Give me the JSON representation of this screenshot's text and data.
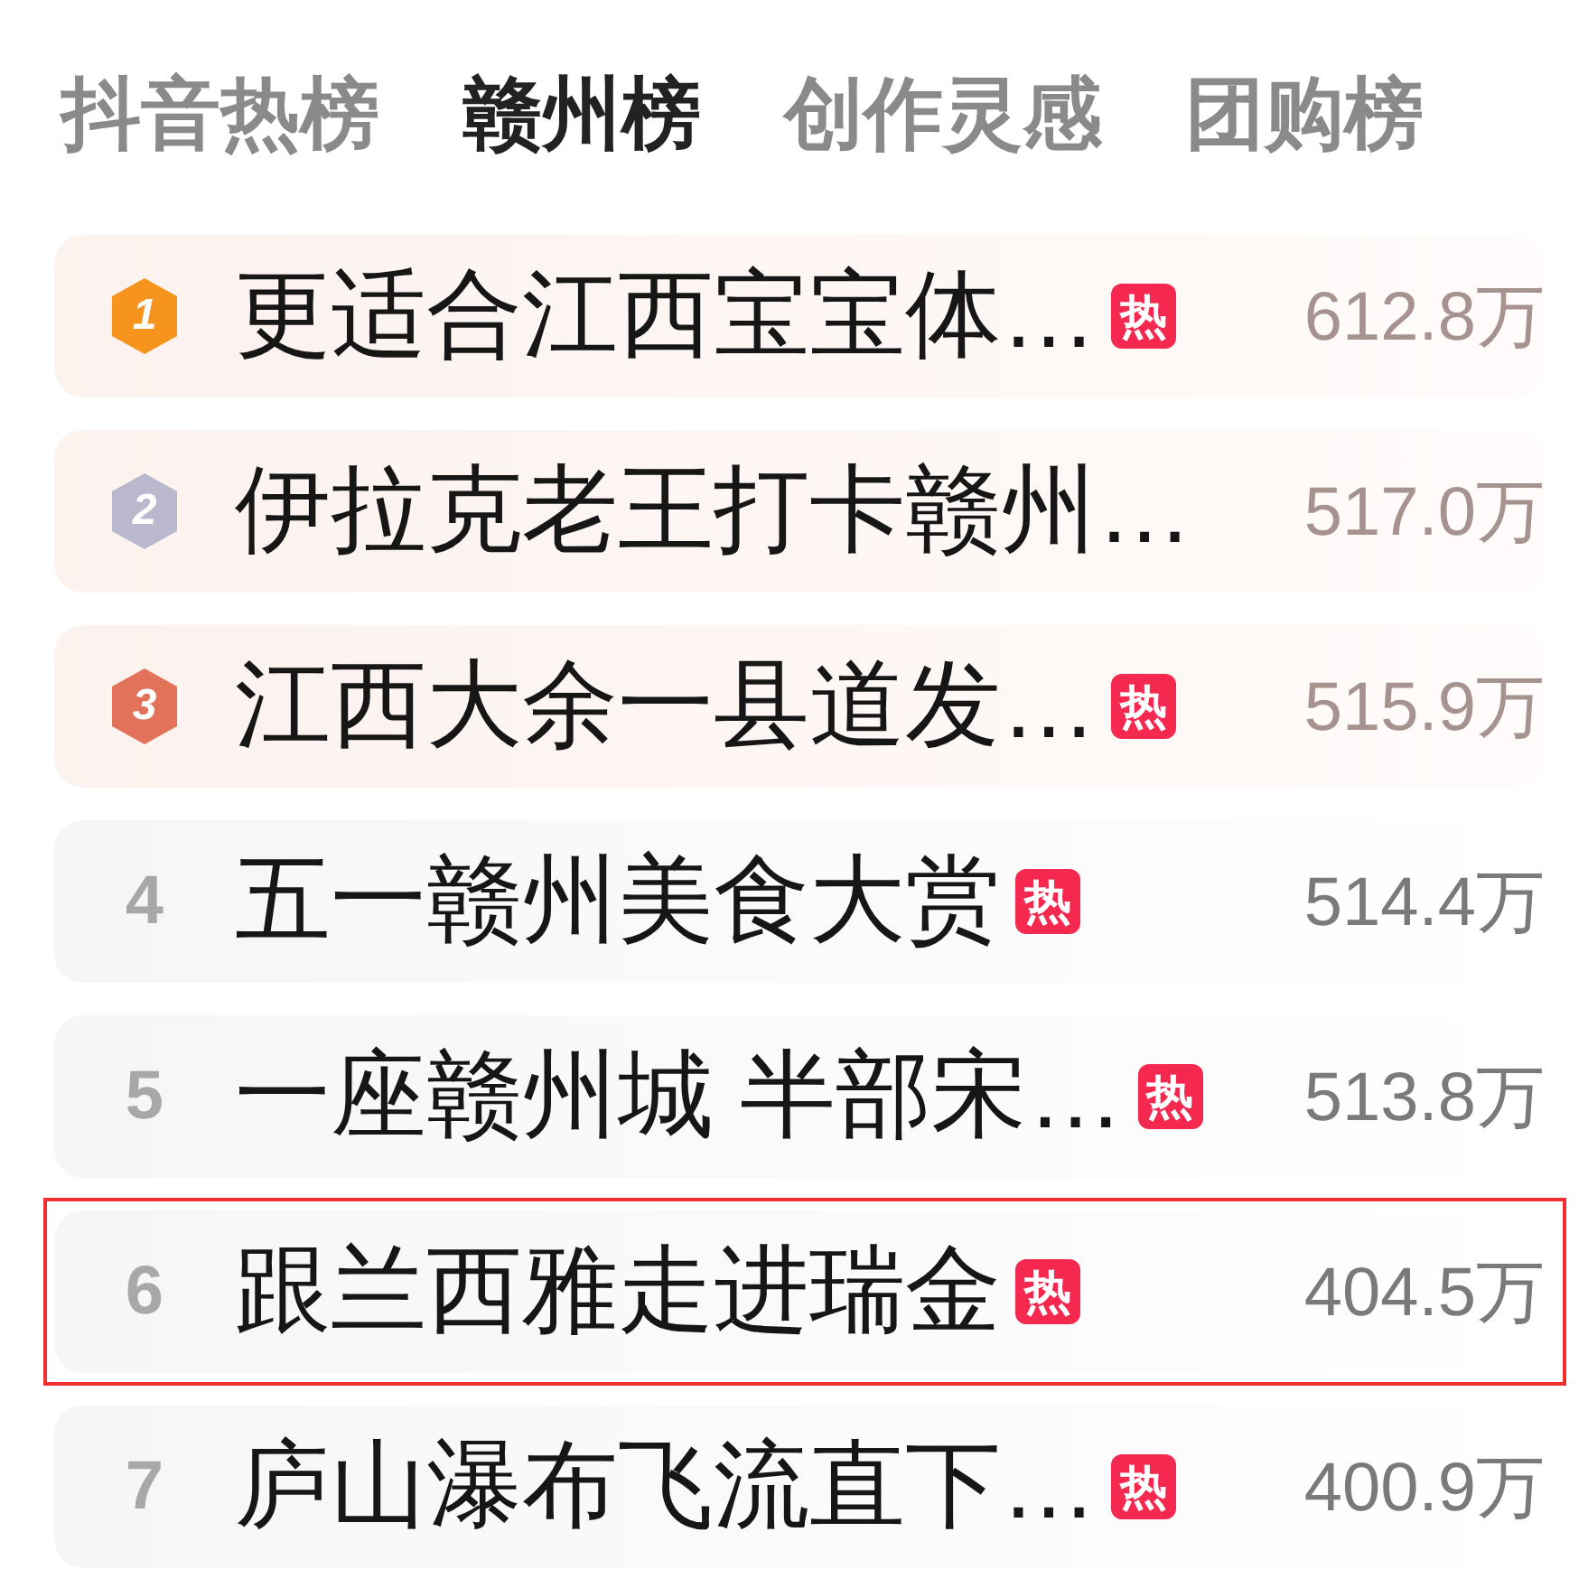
{
  "tabs": [
    {
      "label": "抖音热榜",
      "selected": false
    },
    {
      "label": "赣州榜",
      "selected": true
    },
    {
      "label": "创作灵感",
      "selected": false
    },
    {
      "label": "团购榜",
      "selected": false
    }
  ],
  "rows": [
    {
      "rank": "1",
      "kind": "medal",
      "color": "#f7941d",
      "title": "更适合江西宝宝体…",
      "badge": "热",
      "value": "612.8万",
      "highlighted": false
    },
    {
      "rank": "2",
      "kind": "medal",
      "color": "#b9b8cc",
      "title": "伊拉克老王打卡赣州…",
      "value": "517.0万",
      "highlighted": false
    },
    {
      "rank": "3",
      "kind": "medal",
      "color": "#e2735a",
      "title": "江西大余一县道发…",
      "badge": "热",
      "value": "515.9万",
      "highlighted": false
    },
    {
      "rank": "4",
      "kind": "plain",
      "title": "五一赣州美食大赏",
      "badge": "热",
      "value": "514.4万",
      "highlighted": false
    },
    {
      "rank": "5",
      "kind": "plain",
      "title": "一座赣州城 半部宋…",
      "badge": "热",
      "value": "513.8万",
      "highlighted": false
    },
    {
      "rank": "6",
      "kind": "plain",
      "title": "跟兰西雅走进瑞金",
      "badge": "热",
      "value": "404.5万",
      "highlighted": true
    },
    {
      "rank": "7",
      "kind": "plain",
      "title": "庐山瀑布飞流直下…",
      "badge": "热",
      "value": "400.9万",
      "highlighted": false
    }
  ]
}
